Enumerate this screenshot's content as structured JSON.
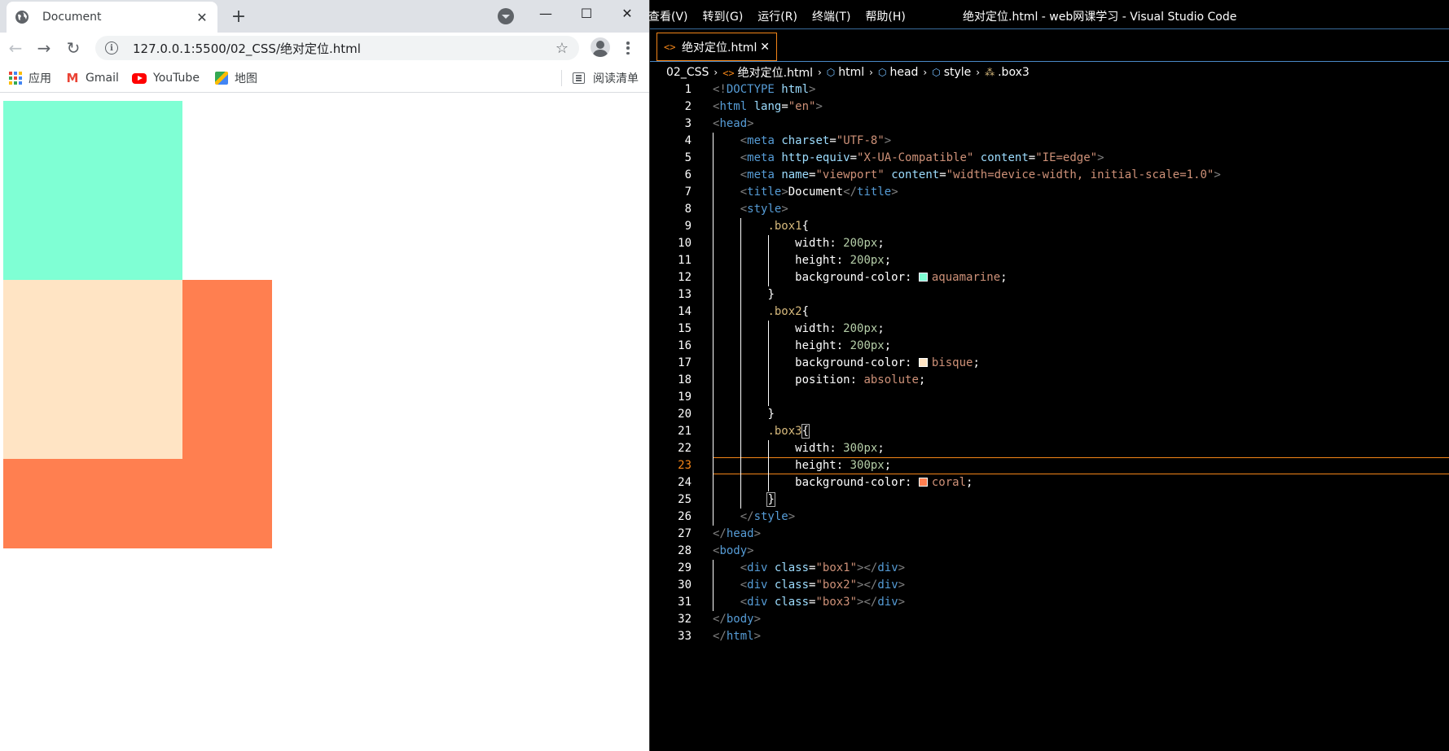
{
  "browser": {
    "tab_title": "Document",
    "url": "127.0.0.1:5500/02_CSS/绝对定位.html",
    "bookmarks": [
      {
        "label": "应用",
        "icon": "apps-icon"
      },
      {
        "label": "Gmail",
        "icon": "gmail-icon"
      },
      {
        "label": "YouTube",
        "icon": "youtube-icon"
      },
      {
        "label": "地图",
        "icon": "maps-icon"
      }
    ],
    "reading_list": "阅读清单",
    "boxes": [
      {
        "name": "box1",
        "color": "#7fffd4"
      },
      {
        "name": "box2",
        "color": "#ffe4c4"
      },
      {
        "name": "box3",
        "color": "#ff7f50"
      }
    ]
  },
  "vscode": {
    "menu": [
      "查看(V)",
      "转到(G)",
      "运行(R)",
      "终端(T)",
      "帮助(H)"
    ],
    "window_title": "绝对定位.html - web网课学习 - Visual Studio Code",
    "tab_name": "绝对定位.html",
    "breadcrumbs": [
      "02_CSS",
      "绝对定位.html",
      "html",
      "head",
      "style",
      ".box3"
    ],
    "active_line": 23,
    "swatch_colors": {
      "aquamarine": "#7fffd4",
      "bisque": "#ffe4c4",
      "coral": "#ff7f50"
    },
    "lines": [
      [
        [
          "t-br",
          "<!"
        ],
        [
          "t-tag",
          "DOCTYPE "
        ],
        [
          "t-attr",
          "html"
        ],
        [
          "t-br",
          ">"
        ]
      ],
      [
        [
          "t-br",
          "<"
        ],
        [
          "t-tag",
          "html "
        ],
        [
          "t-attr",
          "lang"
        ],
        [
          "t-punct",
          "="
        ],
        [
          "t-str",
          "\"en\""
        ],
        [
          "t-br",
          ">"
        ]
      ],
      [
        [
          "t-br",
          "<"
        ],
        [
          "t-tag",
          "head"
        ],
        [
          "t-br",
          ">"
        ]
      ],
      [
        [
          "t-punct",
          "    "
        ],
        [
          "t-br",
          "<"
        ],
        [
          "t-tag",
          "meta "
        ],
        [
          "t-attr",
          "charset"
        ],
        [
          "t-punct",
          "="
        ],
        [
          "t-str",
          "\"UTF-8\""
        ],
        [
          "t-br",
          ">"
        ]
      ],
      [
        [
          "t-punct",
          "    "
        ],
        [
          "t-br",
          "<"
        ],
        [
          "t-tag",
          "meta "
        ],
        [
          "t-attr",
          "http-equiv"
        ],
        [
          "t-punct",
          "="
        ],
        [
          "t-str",
          "\"X-UA-Compatible\" "
        ],
        [
          "t-attr",
          "content"
        ],
        [
          "t-punct",
          "="
        ],
        [
          "t-str",
          "\"IE=edge\""
        ],
        [
          "t-br",
          ">"
        ]
      ],
      [
        [
          "t-punct",
          "    "
        ],
        [
          "t-br",
          "<"
        ],
        [
          "t-tag",
          "meta "
        ],
        [
          "t-attr",
          "name"
        ],
        [
          "t-punct",
          "="
        ],
        [
          "t-str",
          "\"viewport\" "
        ],
        [
          "t-attr",
          "content"
        ],
        [
          "t-punct",
          "="
        ],
        [
          "t-str",
          "\"width=device-width, initial-scale=1.0\""
        ],
        [
          "t-br",
          ">"
        ]
      ],
      [
        [
          "t-punct",
          "    "
        ],
        [
          "t-br",
          "<"
        ],
        [
          "t-tag",
          "title"
        ],
        [
          "t-br",
          ">"
        ],
        [
          "t-text",
          "Document"
        ],
        [
          "t-br",
          "</"
        ],
        [
          "t-tag",
          "title"
        ],
        [
          "t-br",
          ">"
        ]
      ],
      [
        [
          "t-punct",
          "    "
        ],
        [
          "t-br",
          "<"
        ],
        [
          "t-tag",
          "style"
        ],
        [
          "t-br",
          ">"
        ]
      ],
      [
        [
          "t-punct",
          "        "
        ],
        [
          "t-sel",
          ".box1"
        ],
        [
          "t-punct",
          "{"
        ]
      ],
      [
        [
          "t-punct",
          "            "
        ],
        [
          "t-prop",
          "width"
        ],
        [
          "t-punct",
          ": "
        ],
        [
          "t-num",
          "200px"
        ],
        [
          "t-punct",
          ";"
        ]
      ],
      [
        [
          "t-punct",
          "            "
        ],
        [
          "t-prop",
          "height"
        ],
        [
          "t-punct",
          ": "
        ],
        [
          "t-num",
          "200px"
        ],
        [
          "t-punct",
          ";"
        ]
      ],
      [
        [
          "t-punct",
          "            "
        ],
        [
          "t-prop",
          "background-color"
        ],
        [
          "t-punct",
          ": "
        ],
        [
          "swatch",
          "aquamarine"
        ],
        [
          "t-val",
          "aquamarine"
        ],
        [
          "t-punct",
          ";"
        ]
      ],
      [
        [
          "t-punct",
          "        "
        ],
        [
          "t-punct",
          "}"
        ]
      ],
      [
        [
          "t-punct",
          "        "
        ],
        [
          "t-sel",
          ".box2"
        ],
        [
          "t-punct",
          "{"
        ]
      ],
      [
        [
          "t-punct",
          "            "
        ],
        [
          "t-prop",
          "width"
        ],
        [
          "t-punct",
          ": "
        ],
        [
          "t-num",
          "200px"
        ],
        [
          "t-punct",
          ";"
        ]
      ],
      [
        [
          "t-punct",
          "            "
        ],
        [
          "t-prop",
          "height"
        ],
        [
          "t-punct",
          ": "
        ],
        [
          "t-num",
          "200px"
        ],
        [
          "t-punct",
          ";"
        ]
      ],
      [
        [
          "t-punct",
          "            "
        ],
        [
          "t-prop",
          "background-color"
        ],
        [
          "t-punct",
          ": "
        ],
        [
          "swatch",
          "bisque"
        ],
        [
          "t-val",
          "bisque"
        ],
        [
          "t-punct",
          ";"
        ]
      ],
      [
        [
          "t-punct",
          "            "
        ],
        [
          "t-prop",
          "position"
        ],
        [
          "t-punct",
          ": "
        ],
        [
          "t-val",
          "absolute"
        ],
        [
          "t-punct",
          ";"
        ]
      ],
      [],
      [
        [
          "t-punct",
          "        "
        ],
        [
          "t-punct",
          "}"
        ]
      ],
      [
        [
          "t-punct",
          "        "
        ],
        [
          "t-sel",
          ".box3"
        ],
        [
          "bracket",
          "{"
        ]
      ],
      [
        [
          "t-punct",
          "            "
        ],
        [
          "t-prop",
          "width"
        ],
        [
          "t-punct",
          ": "
        ],
        [
          "t-num",
          "300px"
        ],
        [
          "t-punct",
          ";"
        ]
      ],
      [
        [
          "t-punct",
          "            "
        ],
        [
          "t-prop",
          "height"
        ],
        [
          "t-punct",
          ": "
        ],
        [
          "t-num",
          "300px"
        ],
        [
          "t-punct",
          ";"
        ]
      ],
      [
        [
          "t-punct",
          "            "
        ],
        [
          "t-prop",
          "background-color"
        ],
        [
          "t-punct",
          ": "
        ],
        [
          "swatch",
          "coral"
        ],
        [
          "t-val",
          "coral"
        ],
        [
          "t-punct",
          ";"
        ]
      ],
      [
        [
          "t-punct",
          "        "
        ],
        [
          "bracket",
          "}"
        ]
      ],
      [
        [
          "t-punct",
          "    "
        ],
        [
          "t-br",
          "</"
        ],
        [
          "t-tag",
          "style"
        ],
        [
          "t-br",
          ">"
        ]
      ],
      [
        [
          "t-br",
          "</"
        ],
        [
          "t-tag",
          "head"
        ],
        [
          "t-br",
          ">"
        ]
      ],
      [
        [
          "t-br",
          "<"
        ],
        [
          "t-tag",
          "body"
        ],
        [
          "t-br",
          ">"
        ]
      ],
      [
        [
          "t-punct",
          "    "
        ],
        [
          "t-br",
          "<"
        ],
        [
          "t-tag",
          "div "
        ],
        [
          "t-attr",
          "class"
        ],
        [
          "t-punct",
          "="
        ],
        [
          "t-str",
          "\"box1\""
        ],
        [
          "t-br",
          "></"
        ],
        [
          "t-tag",
          "div"
        ],
        [
          "t-br",
          ">"
        ]
      ],
      [
        [
          "t-punct",
          "    "
        ],
        [
          "t-br",
          "<"
        ],
        [
          "t-tag",
          "div "
        ],
        [
          "t-attr",
          "class"
        ],
        [
          "t-punct",
          "="
        ],
        [
          "t-str",
          "\"box2\""
        ],
        [
          "t-br",
          "></"
        ],
        [
          "t-tag",
          "div"
        ],
        [
          "t-br",
          ">"
        ]
      ],
      [
        [
          "t-punct",
          "    "
        ],
        [
          "t-br",
          "<"
        ],
        [
          "t-tag",
          "div "
        ],
        [
          "t-attr",
          "class"
        ],
        [
          "t-punct",
          "="
        ],
        [
          "t-str",
          "\"box3\""
        ],
        [
          "t-br",
          "></"
        ],
        [
          "t-tag",
          "div"
        ],
        [
          "t-br",
          ">"
        ]
      ],
      [
        [
          "t-br",
          "</"
        ],
        [
          "t-tag",
          "body"
        ],
        [
          "t-br",
          ">"
        ]
      ],
      [
        [
          "t-br",
          "</"
        ],
        [
          "t-tag",
          "html"
        ],
        [
          "t-br",
          ">"
        ]
      ]
    ]
  }
}
